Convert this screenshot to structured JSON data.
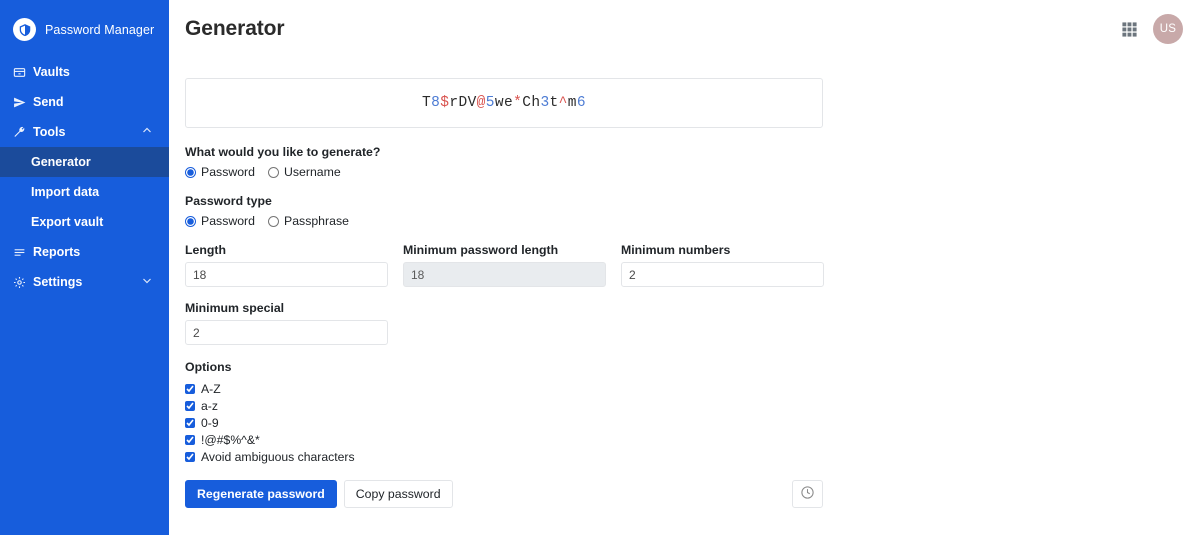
{
  "sidebar": {
    "brand": {
      "name": "Password Manager",
      "logo_icon": "shield-logo-icon"
    },
    "items": [
      {
        "label": "Vaults",
        "icon": "vault-folder-icon",
        "chevron": ""
      },
      {
        "label": "Send",
        "icon": "paper-plane-icon",
        "chevron": ""
      },
      {
        "label": "Tools",
        "icon": "wrench-icon",
        "chevron": "chevron-up-icon"
      },
      {
        "label": "Reports",
        "icon": "list-bars-icon",
        "chevron": ""
      },
      {
        "label": "Settings",
        "icon": "gear-icon",
        "chevron": "chevron-down-icon"
      }
    ],
    "tools_sub": [
      {
        "label": "Generator",
        "active": true
      },
      {
        "label": "Import data",
        "active": false
      },
      {
        "label": "Export vault",
        "active": false
      }
    ],
    "bg_color": "#175ddc",
    "active_color": "#1b4b9b"
  },
  "header": {
    "title": "Generator",
    "apps_icon": "grid-apps-icon",
    "avatar_initials": "US",
    "avatar_color": "#c8a9a9"
  },
  "generated_password": {
    "value": "T8$rDV@5we*Ch3t^m6",
    "letter_color": "#2b2b2b",
    "digit_color": "#4d7cd4",
    "special_color": "#d9534f"
  },
  "form": {
    "generate_question_label": "What would you like to generate?",
    "generate_options": [
      {
        "label": "Password",
        "checked": true
      },
      {
        "label": "Username",
        "checked": false
      }
    ],
    "password_type_label": "Password type",
    "password_type_options": [
      {
        "label": "Password",
        "checked": true
      },
      {
        "label": "Passphrase",
        "checked": false
      }
    ],
    "numeric_fields": [
      {
        "label": "Length",
        "value": "18",
        "disabled": false
      },
      {
        "label": "Minimum password length",
        "value": "18",
        "disabled": true
      },
      {
        "label": "Minimum numbers",
        "value": "2",
        "disabled": false
      },
      {
        "label": "Minimum special",
        "value": "2",
        "disabled": false
      }
    ],
    "options_label": "Options",
    "options": [
      {
        "label": "A-Z",
        "checked": true
      },
      {
        "label": "a-z",
        "checked": true
      },
      {
        "label": "0-9",
        "checked": true
      },
      {
        "label": "!@#$%^&*",
        "checked": true
      },
      {
        "label": "Avoid ambiguous characters",
        "checked": true
      }
    ]
  },
  "actions": {
    "regenerate_label": "Regenerate password",
    "copy_label": "Copy password",
    "history_icon": "clock-history-icon",
    "primary_color": "#175ddc"
  }
}
